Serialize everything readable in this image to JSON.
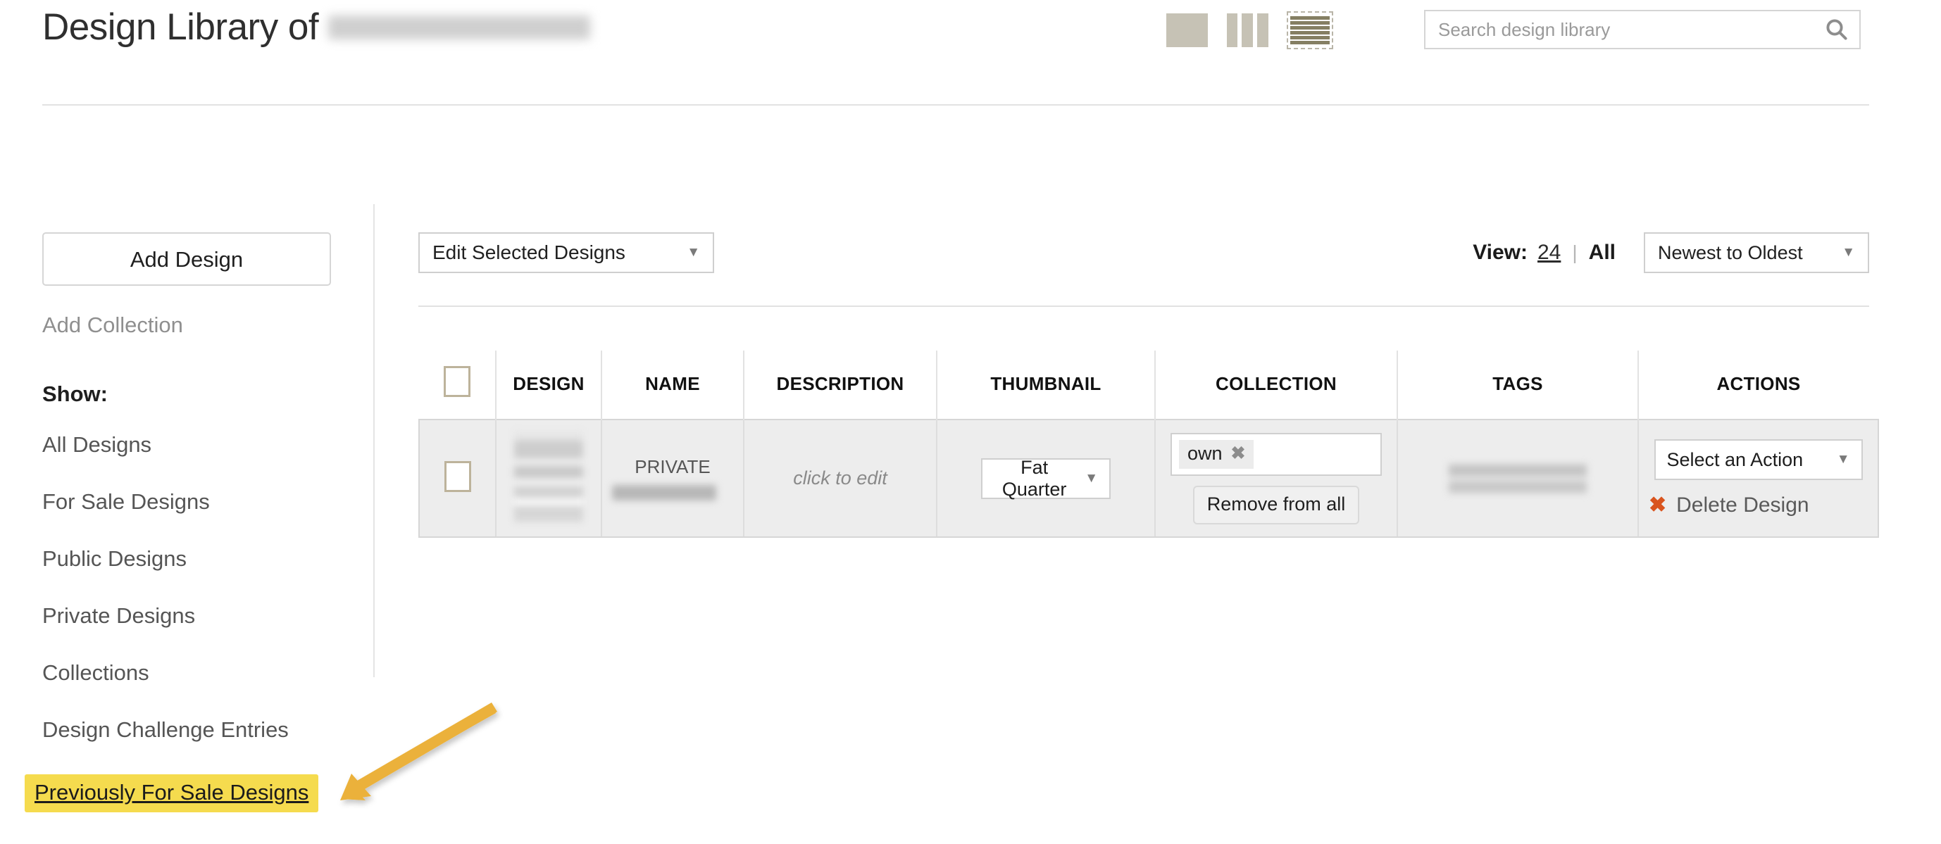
{
  "header": {
    "title_prefix": "Design Library of",
    "title_user_redacted": "",
    "view_toggles": [
      {
        "name": "large-grid-view",
        "label": "Large grid view",
        "selected": false
      },
      {
        "name": "column-grid-view",
        "label": "Column grid view",
        "selected": false
      },
      {
        "name": "list-view",
        "label": "List view",
        "selected": true
      }
    ],
    "search": {
      "placeholder": "Search design library",
      "value": "",
      "icon": "search-icon"
    }
  },
  "sidebar": {
    "add_design_label": "Add Design",
    "add_collection_label": "Add Collection",
    "show_label": "Show:",
    "items": [
      {
        "label": "All Designs",
        "highlighted": false
      },
      {
        "label": "For Sale Designs",
        "highlighted": false
      },
      {
        "label": "Public Designs",
        "highlighted": false
      },
      {
        "label": "Private Designs",
        "highlighted": false
      },
      {
        "label": "Collections",
        "highlighted": false
      },
      {
        "label": "Design Challenge Entries",
        "highlighted": false
      },
      {
        "label": "Previously For Sale Designs",
        "highlighted": true
      }
    ],
    "highlight_color": "#f5db4e"
  },
  "annotation": {
    "arrow_color": "#ebb13a",
    "points_to": "Previously For Sale Designs"
  },
  "toolbar": {
    "edit_selected_label": "Edit Selected Designs",
    "view_label": "View:",
    "view_count_option": "24",
    "view_all_option": "All",
    "view_separator": "|",
    "sort_value": "Newest to Oldest",
    "caret": "▼"
  },
  "table": {
    "columns": [
      {
        "key": "select",
        "label": ""
      },
      {
        "key": "design",
        "label": "DESIGN"
      },
      {
        "key": "name",
        "label": "NAME"
      },
      {
        "key": "description",
        "label": "DESCRIPTION"
      },
      {
        "key": "thumbnail",
        "label": "THUMBNAIL"
      },
      {
        "key": "collection",
        "label": "COLLECTION"
      },
      {
        "key": "tags",
        "label": "TAGS"
      },
      {
        "key": "actions",
        "label": "ACTIONS"
      }
    ],
    "rows": [
      {
        "selected": false,
        "design_thumbnail_redacted": "",
        "name_privacy": "PRIVATE",
        "name_redacted": "",
        "description": "click to edit",
        "thumbnail_value": "Fat Quarter",
        "collection_tag": "own",
        "collection_tag_remove": "✖",
        "collection_remove_all_label": "Remove from all",
        "tags_redacted": "",
        "action_value": "Select an Action",
        "delete_label": "Delete Design",
        "delete_icon": "✖",
        "delete_icon_color": "#d9541e"
      }
    ]
  }
}
